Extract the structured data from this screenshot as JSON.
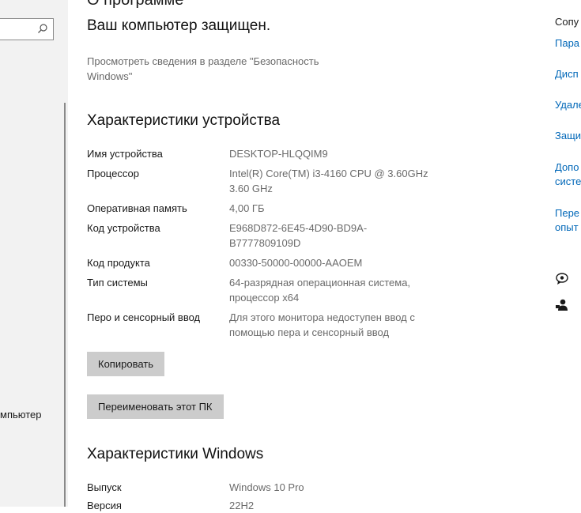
{
  "left_panel": {
    "partial_label": "мпьютер"
  },
  "header_partial": "О программе",
  "security": {
    "status_title": "Ваш компьютер защищен.",
    "details_link": "Просмотреть сведения в разделе \"Безопасность Windows\""
  },
  "device_specs": {
    "heading": "Характеристики устройства",
    "rows": [
      {
        "label": "Имя устройства",
        "value": "DESKTOP-HLQQIM9"
      },
      {
        "label": "Процессор",
        "value": "Intel(R) Core(TM) i3-4160 CPU @ 3.60GHz 3.60 GHz"
      },
      {
        "label": "Оперативная память",
        "value": "4,00 ГБ"
      },
      {
        "label": "Код устройства",
        "value": "E968D872-6E45-4D90-BD9A-B7777809109D"
      },
      {
        "label": "Код продукта",
        "value": "00330-50000-00000-AAOEM"
      },
      {
        "label": "Тип системы",
        "value": "64-разрядная операционная система, процессор x64"
      },
      {
        "label": "Перо и сенсорный ввод",
        "value": "Для этого монитора недоступен ввод с помощью пера и сенсорный ввод"
      }
    ],
    "copy_button": "Копировать",
    "rename_button": "Переименовать этот ПК"
  },
  "windows_specs": {
    "heading": "Характеристики Windows",
    "rows": [
      {
        "label": "Выпуск",
        "value": "Windows 10 Pro"
      },
      {
        "label": "Версия",
        "value": "22H2"
      }
    ]
  },
  "related": {
    "heading": "Сопу",
    "links": [
      "Пара",
      "Дисп",
      "Удале",
      "Защи",
      "Допо",
      "систе",
      "Пере",
      "опыт"
    ]
  },
  "icons": {
    "search": "search-icon",
    "help": "help-chat-icon",
    "feedback": "feedback-person-icon"
  }
}
